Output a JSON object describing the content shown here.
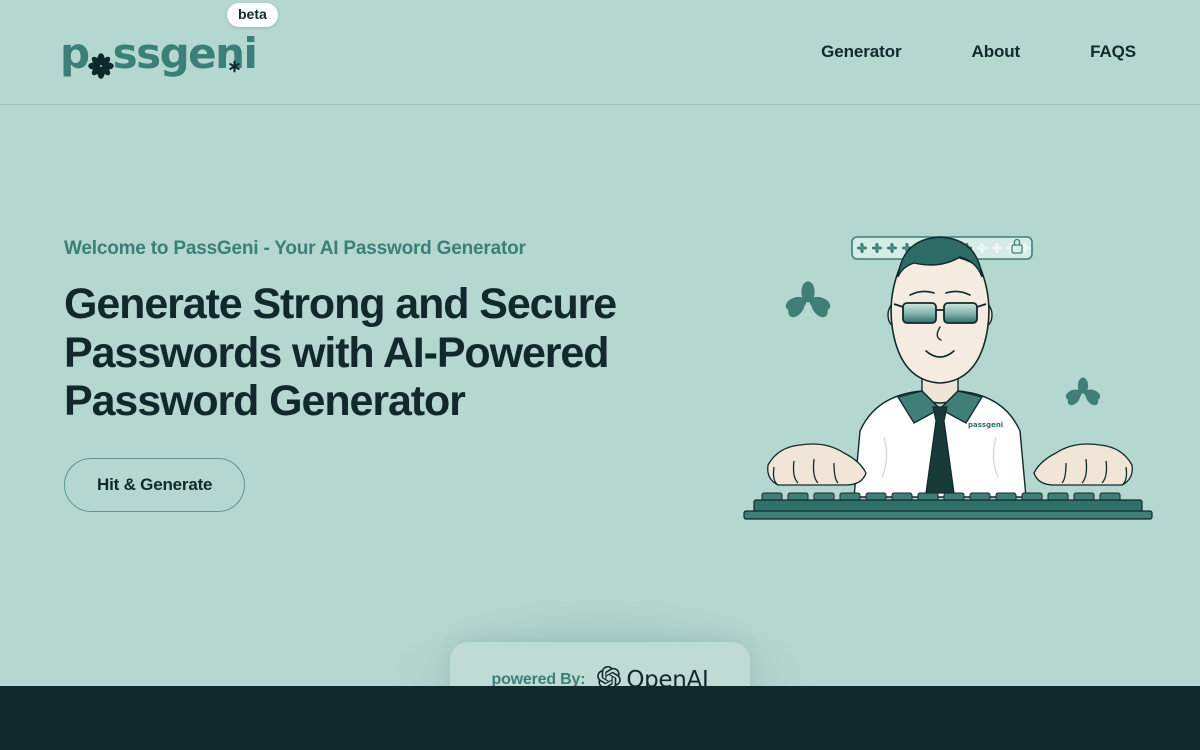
{
  "site": {
    "background_color": "#b4d8d0",
    "accent_color": "#3b7f78",
    "dark_color": "#11292c",
    "footer_color": "#11292c"
  },
  "header": {
    "logo": {
      "text_before_flower": "p",
      "flower_icon": "flower-asterisk-icon",
      "text_after_flower": "ssgeni",
      "full_text": "passgeni",
      "dot_icon": "asterisk-dot-icon"
    },
    "badge": "beta",
    "nav": [
      {
        "label": "Generator",
        "name": "nav-item-generator"
      },
      {
        "label": "About",
        "name": "nav-item-about"
      },
      {
        "label": "FAQS",
        "name": "nav-item-faqs"
      }
    ]
  },
  "hero": {
    "eyebrow": "Welcome to PassGeni - Your AI Password Generator",
    "headline": "Generate Strong and Secure Passwords with AI-Powered Password Generator",
    "cta_label": "Hit & Generate"
  },
  "illustration": {
    "password_field": {
      "filled_dots": 8,
      "empty_dots": 4,
      "total_dots": 12,
      "dot_icon": "flower-asterisk-icon",
      "lock_icon": "lock-icon"
    },
    "character": {
      "name": "person-typing-illustration",
      "shirt_logo_text": "passgeni",
      "accessories": [
        "sunglasses",
        "necktie",
        "collared-shirt"
      ]
    },
    "keyboard": {
      "name": "keyboard-illustration",
      "key_count": 14
    },
    "decorations": [
      {
        "name": "flower-decoration-left",
        "size": 44
      },
      {
        "name": "flower-decoration-right",
        "size": 34
      }
    ]
  },
  "powered": {
    "label": "powered By:",
    "brand_name": "OpenAI",
    "brand_icon": "openai-logo-icon"
  }
}
